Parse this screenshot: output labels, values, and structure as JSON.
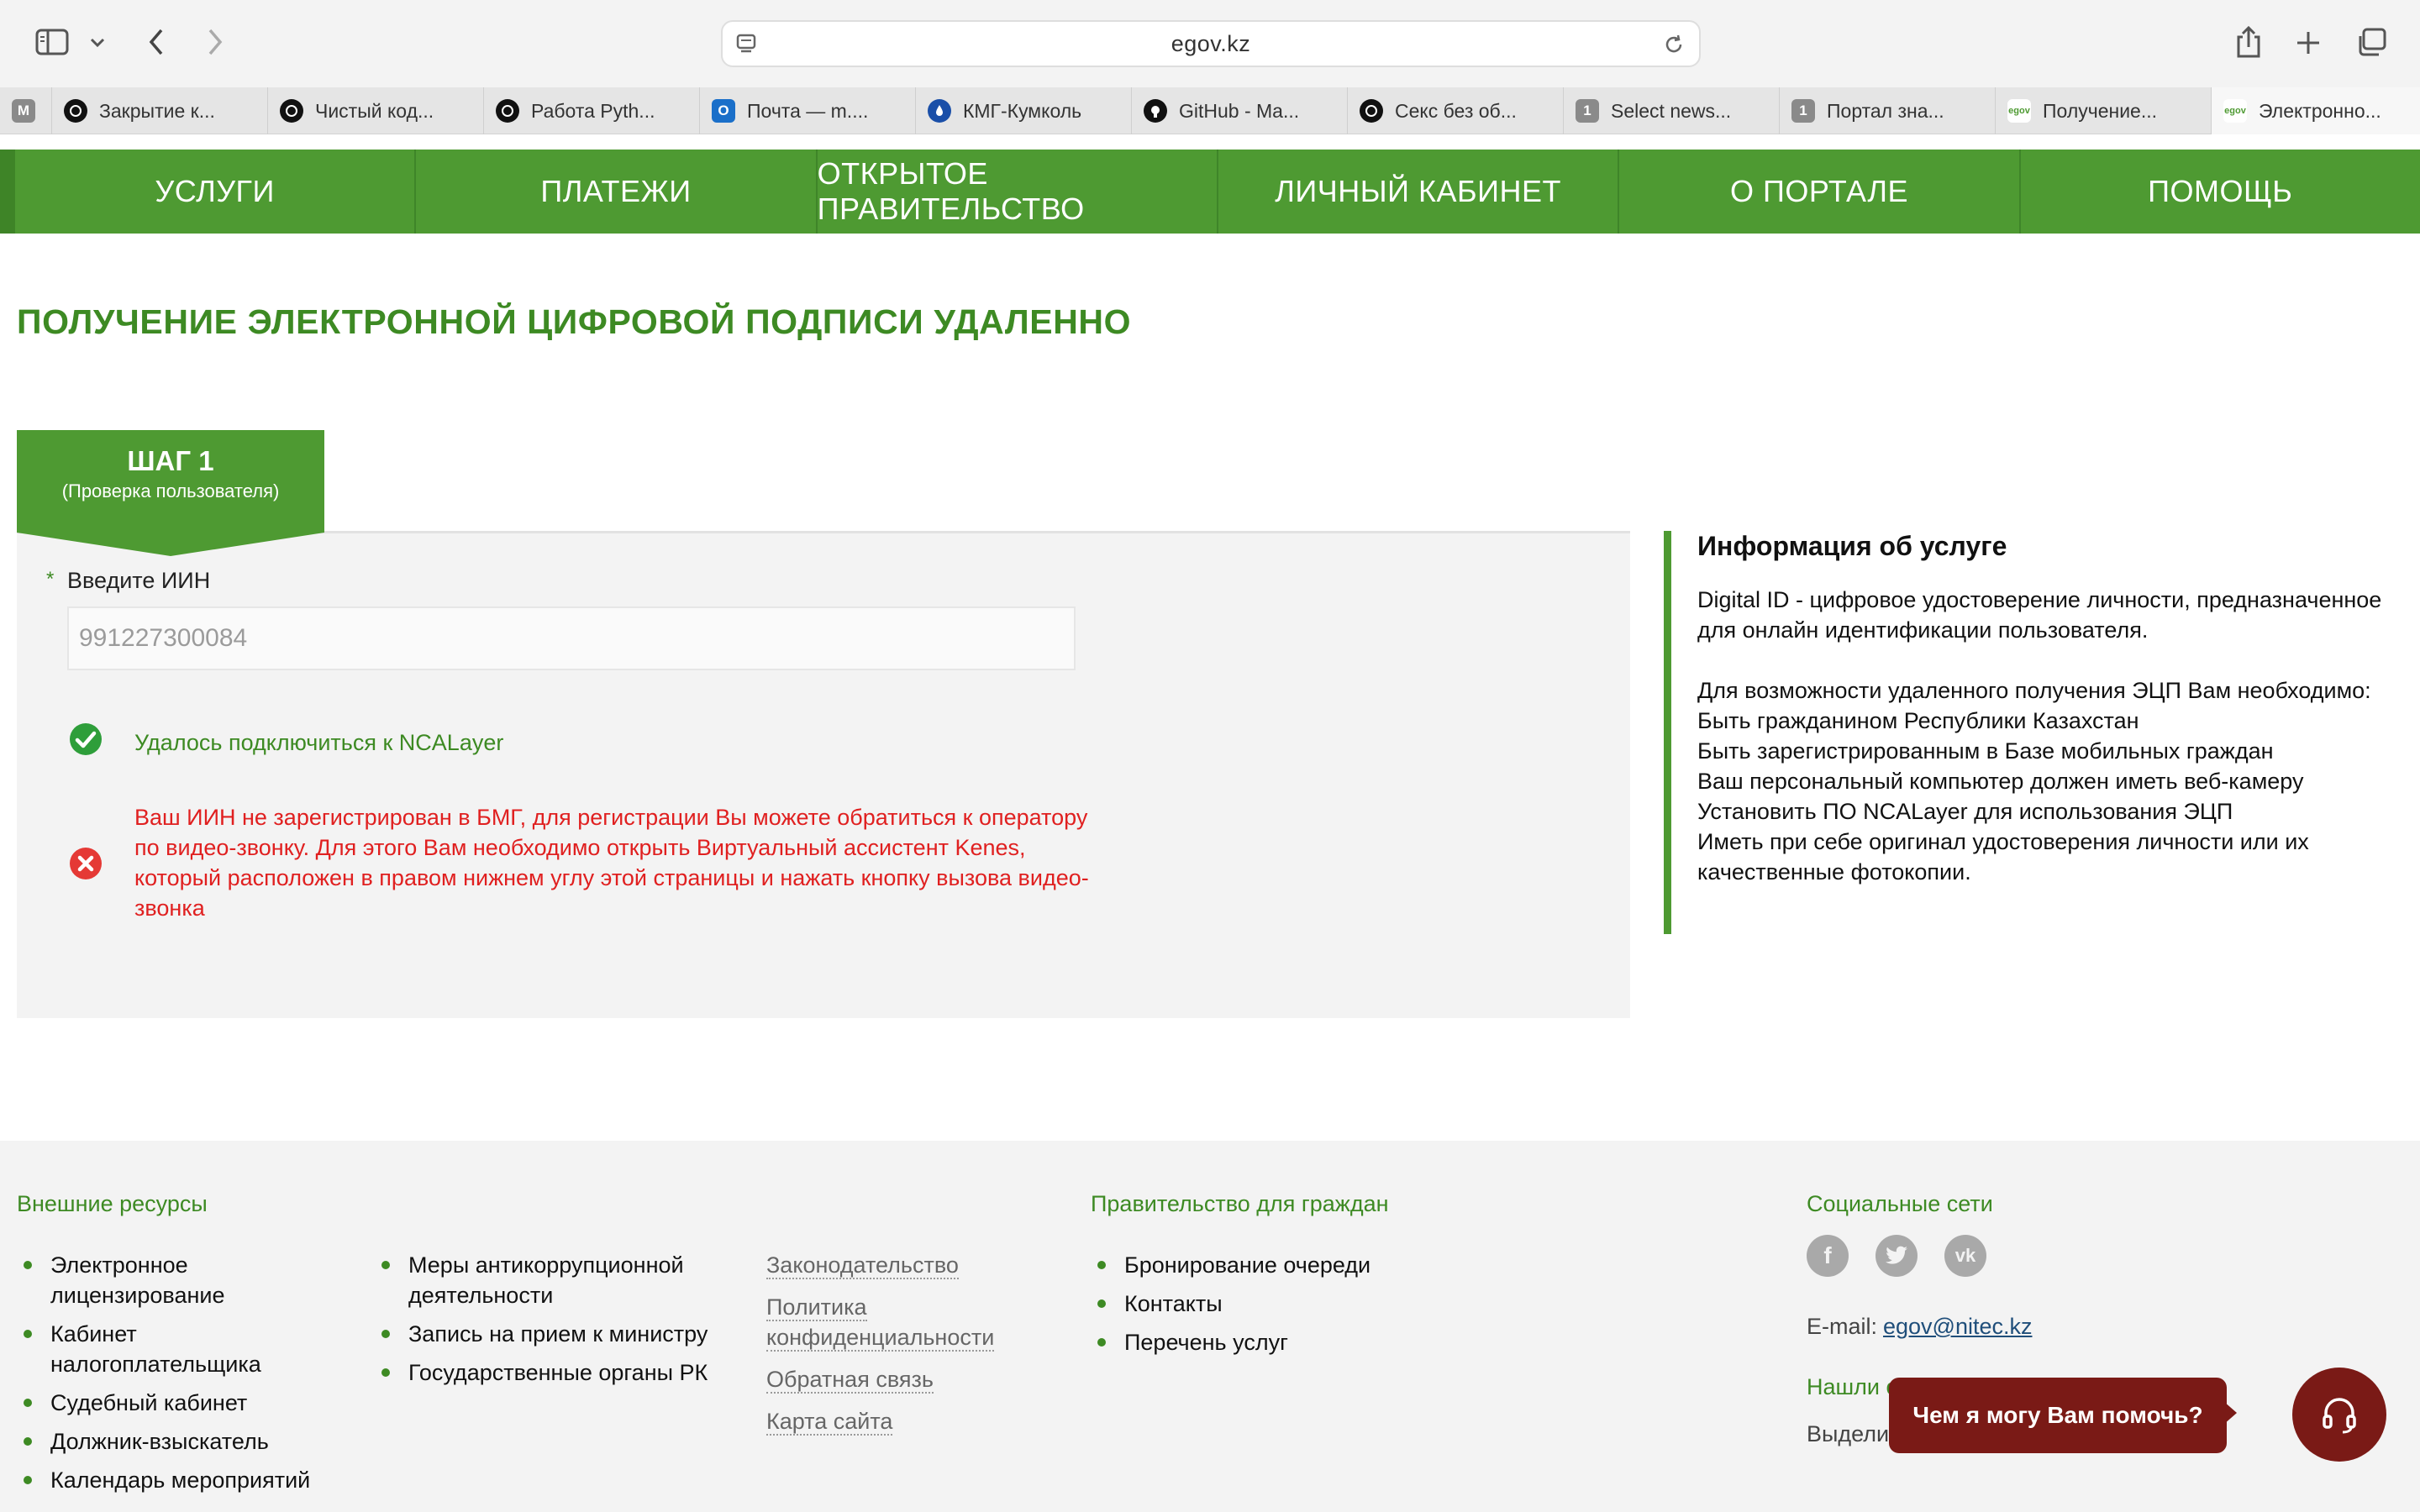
{
  "browser": {
    "url": "egov.kz",
    "tabs": [
      {
        "label": "M",
        "favicon": "M",
        "favicon_color": "#8a8a8a"
      },
      {
        "label": "Закрытие к...",
        "favicon": "chatgpt-icon",
        "favicon_color": "#111111"
      },
      {
        "label": "Чистый код...",
        "favicon": "chatgpt-icon",
        "favicon_color": "#111111"
      },
      {
        "label": "Работа Pyth...",
        "favicon": "chatgpt-icon",
        "favicon_color": "#111111"
      },
      {
        "label": "Почта — m....",
        "favicon": "outlook-icon",
        "favicon_color": "#1a6fc9"
      },
      {
        "label": "КМГ-Кумколь",
        "favicon": "drop-icon",
        "favicon_color": "#1a4fa8"
      },
      {
        "label": "GitHub - Ma...",
        "favicon": "github-icon",
        "favicon_color": "#111111"
      },
      {
        "label": "Секс без об...",
        "favicon": "chatgpt-icon",
        "favicon_color": "#111111"
      },
      {
        "label": "Select news...",
        "favicon": "1",
        "favicon_color": "#8a8a8a"
      },
      {
        "label": "Портал зна...",
        "favicon": "1",
        "favicon_color": "#8a8a8a"
      },
      {
        "label": "Получение...",
        "favicon": "egov-icon",
        "favicon_color": "#4e9a32"
      },
      {
        "label": "Электронно...",
        "favicon": "egov-icon",
        "favicon_color": "#4e9a32"
      }
    ]
  },
  "nav": {
    "items": [
      "УСЛУГИ",
      "ПЛАТЕЖИ",
      "ОТКРЫТОЕ ПРАВИТЕЛЬСТВО",
      "ЛИЧНЫЙ КАБИНЕТ",
      "О ПОРТАЛЕ",
      "ПОМОЩЬ"
    ]
  },
  "page": {
    "title": "ПОЛУЧЕНИЕ ЭЛЕКТРОННОЙ ЦИФРОВОЙ ПОДПИСИ УДАЛЕННО",
    "step": {
      "title": "ШАГ 1",
      "subtitle": "(Проверка пользователя)"
    },
    "form": {
      "required_mark": "*",
      "iin_label": "Введите ИИН",
      "iin_value": "991227300084",
      "success_message": "Удалось подключиться к NCALayer",
      "error_message": "Ваш ИИН не зарегистрирован в БМГ,  для регистрации Вы можете обратиться к оператору по видео-звонку.  Для этого Вам необходимо открыть Виртуальный ассистент Kenes, который расположен в правом нижнем углу этой страницы и нажать кнопку вызова видео-звонка"
    },
    "info": {
      "title": "Информация об услуге",
      "intro": "Digital ID - цифровое удостоверение личности, предназначенное для онлайн идентификации пользователя.",
      "requirements_heading": "Для возможности удаленного получения ЭЦП Вам необходимо:",
      "requirements": [
        "Быть гражданином Республики Казахстан",
        "Быть зарегистрированным в Базе мобильных граждан",
        "Ваш персональный компьютер должен иметь веб-камеру",
        "Установить ПО NCALayer для использования ЭЦП",
        "Иметь при себе оригинал удостоверения личности или их качественные фотокопии."
      ]
    }
  },
  "footer": {
    "external_heading": "Внешние ресурсы",
    "external_col1": [
      "Электронное лицензирование",
      "Кабинет налогоплательщика",
      "Судебный кабинет",
      "Должник-взыскатель",
      "Календарь мероприятий"
    ],
    "external_col2": [
      "Меры антикоррупционной деятельности",
      "Запись на прием к министру",
      "Государственные органы РК"
    ],
    "links": [
      "Законодательство",
      "Политика конфиденциальности",
      "Обратная связь",
      "Карта сайта"
    ],
    "gov_heading": "Правительство для граждан",
    "gov_items": [
      "Бронирование очереди",
      "Контакты",
      "Перечень услуг"
    ],
    "social_heading": "Социальные сети",
    "email_label": "E-mail:",
    "email": "egov@nitec.kz",
    "found_partial": "Нашли о",
    "select_partial": "Выделит"
  },
  "chat": {
    "prompt": "Чем я могу Вам помочь?"
  },
  "colors": {
    "brand_green": "#4e9a32",
    "title_green": "#3d8a23",
    "error_red": "#e02020",
    "chat_maroon": "#7a1a16"
  }
}
